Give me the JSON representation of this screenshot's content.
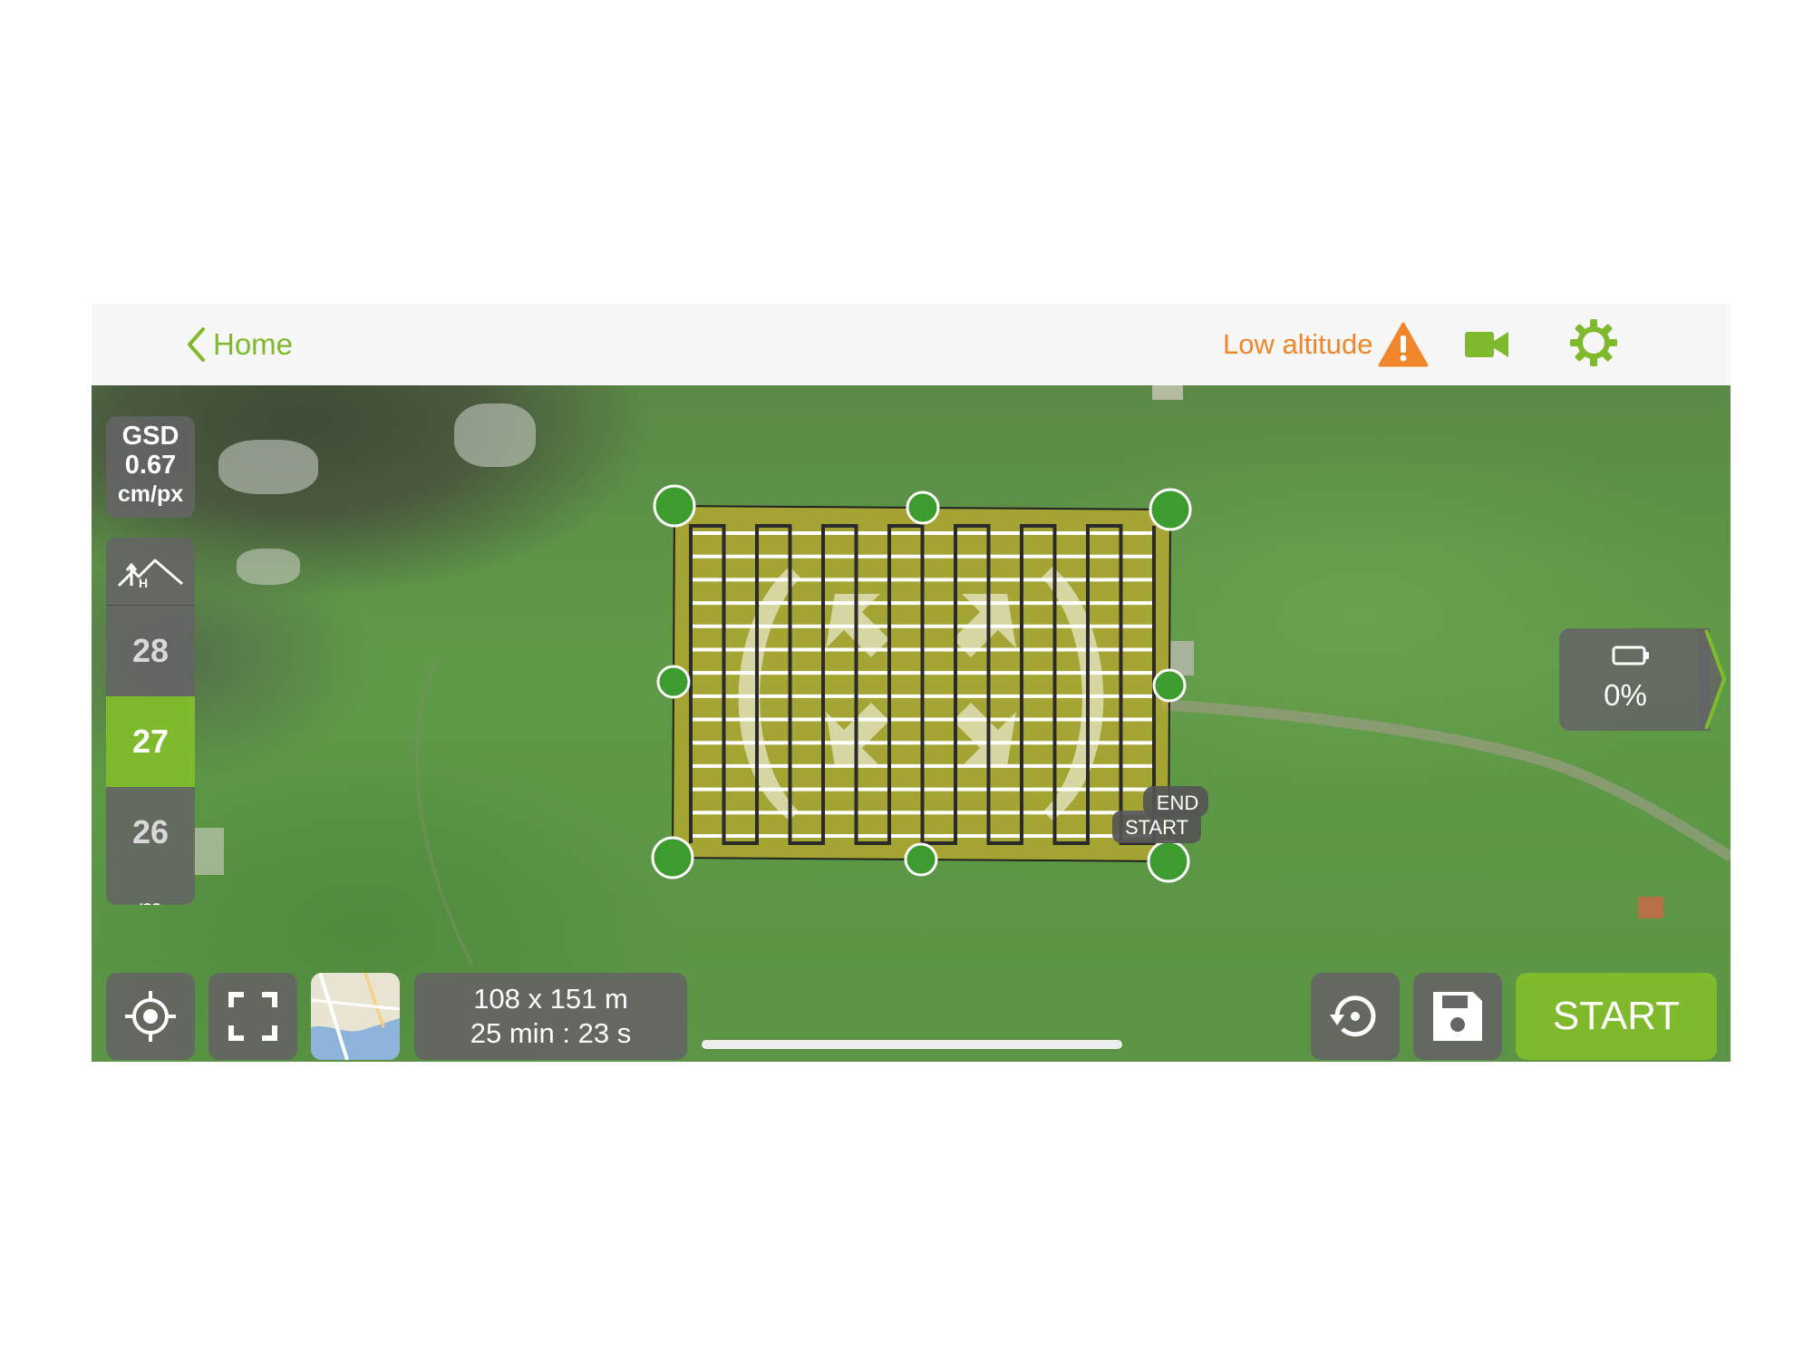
{
  "topbar": {
    "back_label": "Home",
    "warning_label": "Low altitude",
    "icons": [
      "chevron-left-icon",
      "warning-triangle-icon",
      "video-camera-icon",
      "gear-icon"
    ],
    "accent_color": "#7fba2c",
    "warning_color": "#f0852a"
  },
  "gsd": {
    "label": "GSD",
    "value": "0.67",
    "unit": "cm/px"
  },
  "altitude": {
    "above": "28",
    "selected": "27",
    "below": "26",
    "unit": "m",
    "icon": "terrain-height-icon"
  },
  "flight_plan": {
    "end_label": "END",
    "start_label": "START"
  },
  "battery": {
    "percent": "0%",
    "icon": "battery-icon"
  },
  "stats": {
    "dimensions": "108 x 151 m",
    "duration": "25 min : 23 s"
  },
  "bottom": {
    "start_label": "START",
    "icons": [
      "locate-icon",
      "fullscreen-icon",
      "map-type-icon",
      "reset-icon",
      "save-icon"
    ]
  }
}
